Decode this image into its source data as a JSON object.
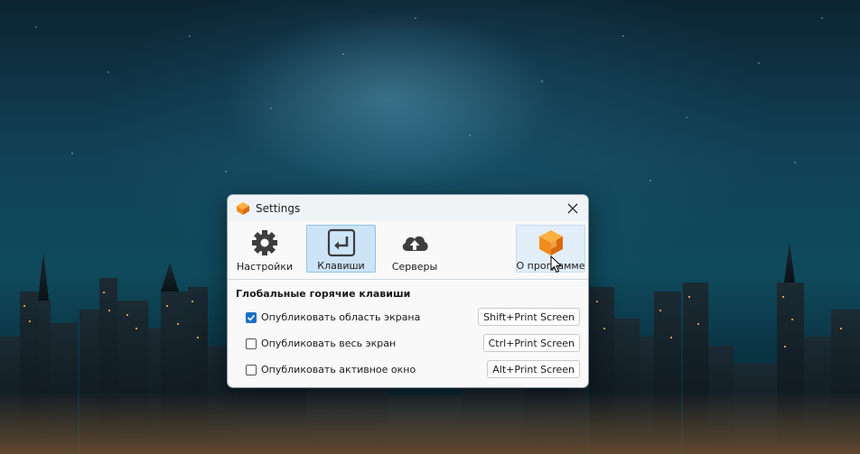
{
  "window": {
    "title": "Settings",
    "app_icon": "orange-cube-icon",
    "close_icon": "close-icon"
  },
  "toolbar": {
    "items": [
      {
        "label": "Настройки",
        "icon": "gear-icon",
        "state": "normal"
      },
      {
        "label": "Клавиши",
        "icon": "enter-key-icon",
        "state": "selected"
      },
      {
        "label": "Серверы",
        "icon": "cloud-upload-icon",
        "state": "normal"
      },
      {
        "label": "О программе",
        "icon": "orange-cube-icon",
        "state": "hover"
      }
    ]
  },
  "hotkeys": {
    "section_title": "Глобальные горячие клавиши",
    "rows": [
      {
        "label": "Опубликовать область экрана",
        "checked": true,
        "shortcut": "Shift+Print Screen"
      },
      {
        "label": "Опубликовать весь экран",
        "checked": false,
        "shortcut": "Ctrl+Print Screen"
      },
      {
        "label": "Опубликовать активное окно",
        "checked": false,
        "shortcut": "Alt+Print Screen"
      }
    ]
  },
  "colors": {
    "accent": "#1a6fc4",
    "selected_bg": "#cde4f7",
    "brand_orange": "#f28a1d"
  }
}
